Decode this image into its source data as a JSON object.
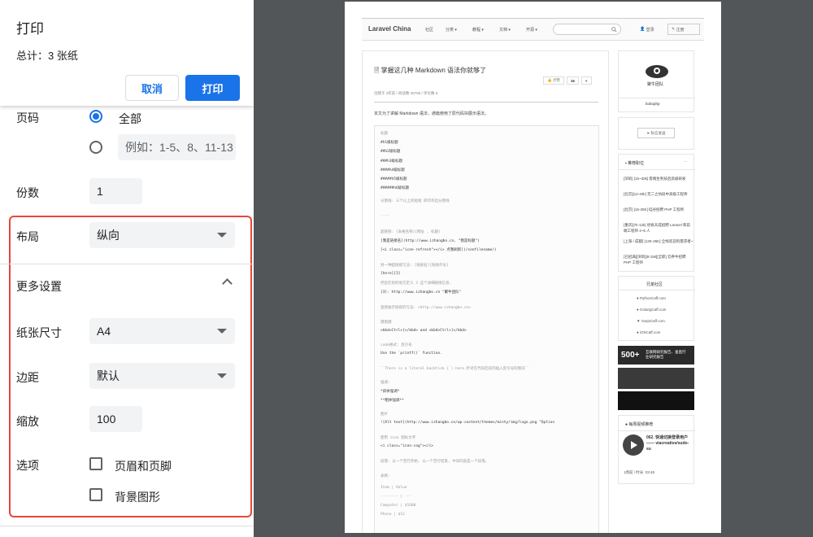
{
  "dialog": {
    "title": "打印",
    "total": "总计：3 张纸",
    "cancel": "取消",
    "print": "打印"
  },
  "pages": {
    "label": "页码",
    "all": "全部",
    "custom_placeholder": "例如：1-5、8、11-13",
    "selected": "all"
  },
  "copies": {
    "label": "份数",
    "value": "1"
  },
  "layout": {
    "label": "布局",
    "value": "纵向"
  },
  "more": {
    "label": "更多设置",
    "expanded": true
  },
  "paper": {
    "label": "纸张尺寸",
    "value": "A4"
  },
  "margins": {
    "label": "边距",
    "value": "默认"
  },
  "scale": {
    "label": "缩放",
    "value": "100"
  },
  "options": {
    "label": "选项",
    "headers_footers": "页眉和页脚",
    "background": "背景图形",
    "headers_footers_checked": false,
    "background_checked": false
  },
  "colors": {
    "accent": "#1a73e8",
    "highlight": "#e8453c",
    "preview_bg": "#525659"
  },
  "preview": {
    "nav": {
      "brand": "Laravel China",
      "items": [
        "社区",
        "分类 ▾",
        "教程 ▾",
        "文档 ▾",
        "开源 ▾"
      ],
      "login": "登录",
      "register": "注册"
    },
    "article": {
      "title": "掌握这几种 Markdown 语法你就够了",
      "meta": "创建于 3年前  /  阅读数 45768  /  评论数 6",
      "like": "点赞",
      "like_count": "16",
      "intro": "本文为了讲解 Markdown 语法，通篇使用了原代码块展示语法。"
    },
    "code_lines": [
      {
        "t": "标题",
        "g": true
      },
      {
        "t": "#h1级标题",
        "g": false
      },
      {
        "t": "##h2级标题",
        "g": false
      },
      {
        "t": "###h3级标题",
        "g": false
      },
      {
        "t": "####h4级标题",
        "g": false
      },
      {
        "t": "#####h5级标题",
        "g": false
      },
      {
        "t": "######h6级标题",
        "g": false
      },
      {
        "t": "分割线: 三个以上的短线 即可作出分割线",
        "g": true
      },
      {
        "t": "----",
        "g": true
      },
      {
        "t": "超链接: [表格名称](网址 , 标题)",
        "g": true
      },
      {
        "t": "[我是链接名](http://www.izhangbo.cn, \"我是标题\")",
        "g": false
      },
      {
        "t": "[<i class=\"icon-refresh\"></i> 点我刷新](/sonfilename/)",
        "g": false
      },
      {
        "t": "另一种超链接写法: [链接名][链接代号]",
        "g": true
      },
      {
        "t": "[here][3]",
        "g": false
      },
      {
        "t": "然后在别的地方定义 3 这个详细链接信息,",
        "g": true
      },
      {
        "t": "[3]: http://www.izhangbo.cn \"聚牛团队\"",
        "g": false
      },
      {
        "t": "直接展示链接的写法: <http://www.izhangbo.cn>",
        "g": true
      },
      {
        "t": "键盘键",
        "g": true
      },
      {
        "t": "<kbd>Ctrl+[</kbd> and <kbd>Ctrl+]</kbd>",
        "g": false
      },
      {
        "t": "code格式: 反引号",
        "g": true
      },
      {
        "t": "Use the `printf()` function.",
        "g": false
      },
      {
        "t": "``There is a literal backtick (`) here.针对在代码区段内插入反引号的情况``",
        "g": true
      },
      {
        "t": "强调:",
        "g": true
      },
      {
        "t": "*斜体强调*",
        "g": false
      },
      {
        "t": "**粗体强调**",
        "g": false
      },
      {
        "t": "图片",
        "g": true
      },
      {
        "t": "![Alt text](http://www.izhangbo.cn/wp-content/themes/minty/img/logo.png \"Option",
        "g": false
      },
      {
        "t": "使用 icon 图标文字",
        "g": true
      },
      {
        "t": "<i class=\"icon-cog\"></i>",
        "g": false
      },
      {
        "t": "段落: 以一个空行开始, 以一个空行结束, 中间的就是一个段落。",
        "g": true
      },
      {
        "t": "表格:",
        "g": true
      },
      {
        "t": "Item     | Value",
        "g": true
      },
      {
        "t": "-------- | ---",
        "g": true
      },
      {
        "t": "Computer | $1600",
        "g": true
      },
      {
        "t": "Phone    | $12",
        "g": true
      }
    ],
    "sidebar": {
      "logo_text": "聚牛团队",
      "username": "bobophp",
      "send_btn": "私信发送",
      "jobs_title": "推荐职位",
      "jobs": [
        "[深圳] [15~30k] 客端生利技后高级研发",
        "[北京][12-40k] 无二之坊段中高级工程师",
        "[北京] [15-30K] 硅谷招聘 PHP 工程师",
        "[重庆][7k-12k] 优帆天成招聘 Laravel 和前端工程师 4~5 人",
        "[上海 / 成都]  [13K-25K] 全栈欢迎的需求者~",
        "[已招满][深圳][8-15k][全职] 云养牛招聘 PHP 工程师"
      ],
      "community_title": "兄弟社区",
      "community": [
        "PythonCaff.com",
        "GolangCaff.com",
        "VuejsCaff.com",
        "iOSCaff.com"
      ],
      "banner_text": "500+",
      "banner_sub": "互联网研究报告、垂直行业研究报告",
      "video_title": "每周视频推荐",
      "video_name": "062. 快速切换登录用户 —— viacreative/sudo-su",
      "video_meta": "1周前 / 时长: 03:48"
    }
  }
}
